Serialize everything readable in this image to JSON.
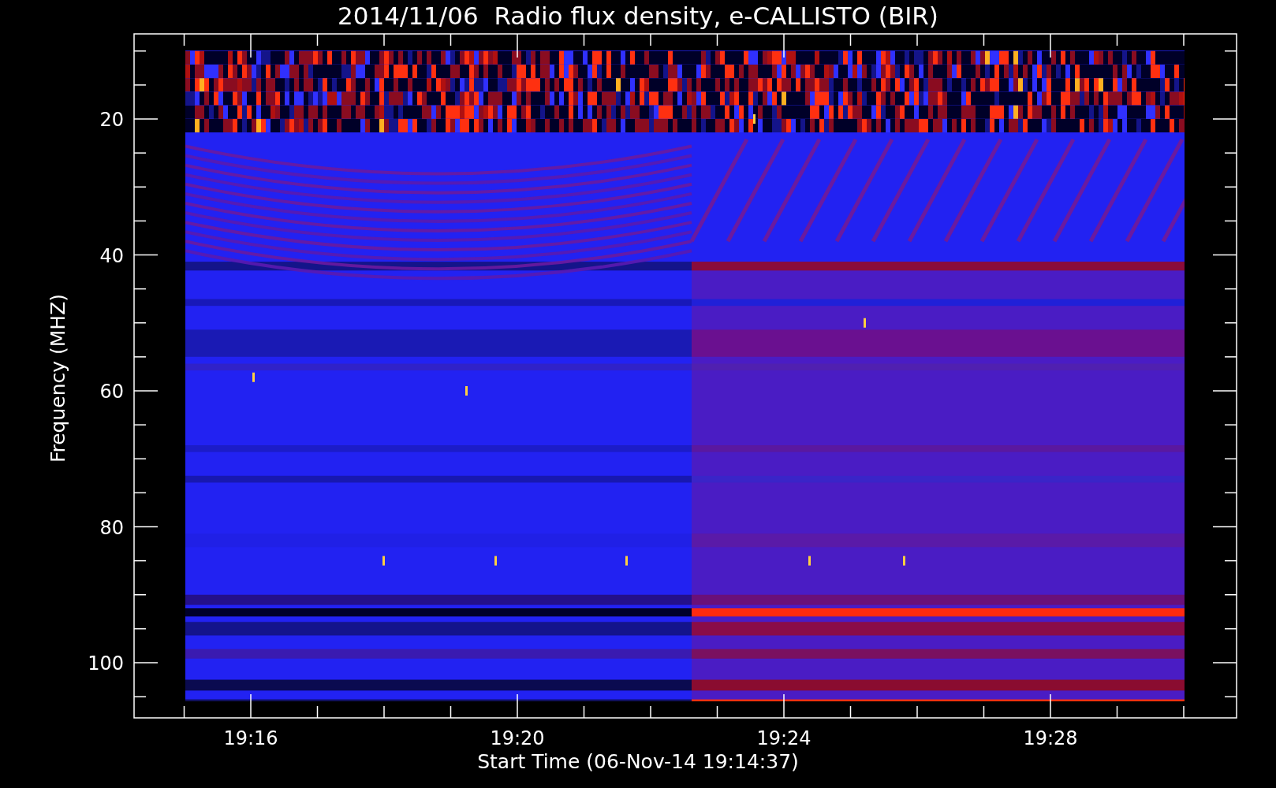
{
  "plot": {
    "title": "2014/11/06  Radio flux density, e-CALLISTO (BIR)",
    "xlabel": "Start Time (06-Nov-14 19:14:37)",
    "ylabel": "Frequency (MHZ)",
    "xticks": [
      "19:16",
      "19:20",
      "19:24",
      "19:28"
    ],
    "yticks": [
      "20",
      "40",
      "60",
      "80",
      "100"
    ]
  }
}
